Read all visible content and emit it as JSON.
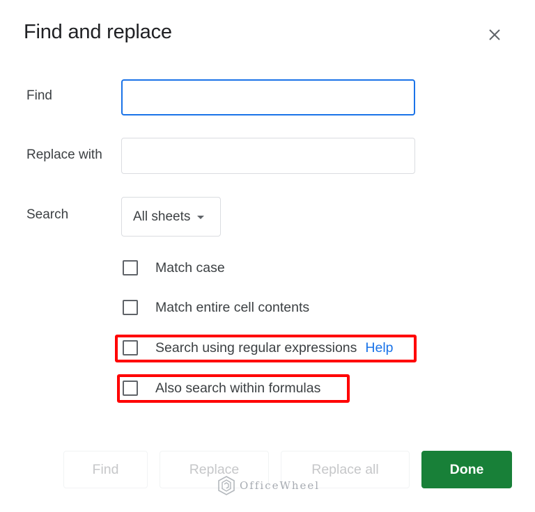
{
  "dialog": {
    "title": "Find and replace",
    "close_icon": "close-icon"
  },
  "fields": {
    "find": {
      "label": "Find",
      "value": "",
      "placeholder": "",
      "focused": true
    },
    "replace": {
      "label": "Replace with",
      "value": "",
      "placeholder": ""
    },
    "search": {
      "label": "Search",
      "selected": "All sheets"
    }
  },
  "options": [
    {
      "label": "Match case",
      "checked": false,
      "highlighted": false
    },
    {
      "label": "Match entire cell contents",
      "checked": false,
      "highlighted": false
    },
    {
      "label": "Search using regular expressions",
      "checked": false,
      "highlighted": true,
      "link": "Help"
    },
    {
      "label": "Also search within formulas",
      "checked": false,
      "highlighted": true
    }
  ],
  "buttons": {
    "find": "Find",
    "replace": "Replace",
    "replace_all": "Replace all",
    "done": "Done"
  },
  "watermark": {
    "text": "OfficeWheel"
  },
  "colors": {
    "accent_blue": "#1a73e8",
    "primary_green": "#188038",
    "highlight_red": "#ff0000"
  }
}
